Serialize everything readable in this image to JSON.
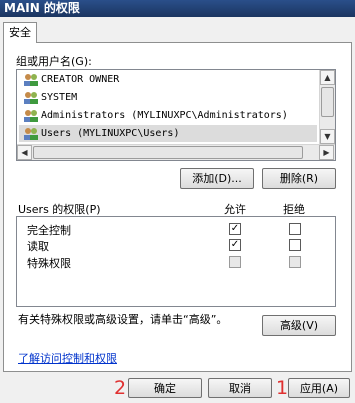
{
  "title": "MAIN 的权限",
  "tab_label": "安全",
  "group_label": "组或用户名(G):",
  "users": [
    {
      "name": "CREATOR OWNER",
      "selected": false
    },
    {
      "name": "SYSTEM",
      "selected": false
    },
    {
      "name": "Administrators (MYLINUXPC\\Administrators)",
      "selected": false
    },
    {
      "name": "Users (MYLINUXPC\\Users)",
      "selected": true
    }
  ],
  "add_button": "添加(D)...",
  "remove_button": "删除(R)",
  "perm_for_label": "Users 的权限(P)",
  "allow_header": "允许",
  "deny_header": "拒绝",
  "permissions": [
    {
      "name": "完全控制",
      "allow": "✓",
      "deny": ""
    },
    {
      "name": "读取",
      "allow": "✓",
      "deny": ""
    },
    {
      "name": "特殊权限",
      "allow": "",
      "deny": ""
    }
  ],
  "special_note": "有关特殊权限或高级设置，请单击“高级”。",
  "advanced_button": "高级(V)",
  "learn_link": "了解访问控制和权限",
  "ok_button": "确定",
  "cancel_button": "取消",
  "apply_button": "应用(A)",
  "annotation_ok": "2",
  "annotation_apply": "1"
}
